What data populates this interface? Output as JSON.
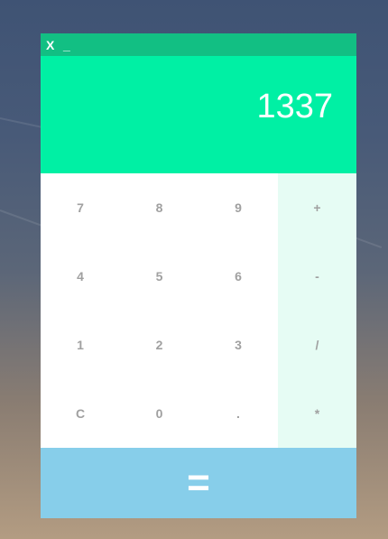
{
  "window": {
    "close_label": "X",
    "minimize_label": "_"
  },
  "display": {
    "value": "1337"
  },
  "keypad": {
    "rows": [
      [
        "7",
        "8",
        "9",
        "+"
      ],
      [
        "4",
        "5",
        "6",
        "-"
      ],
      [
        "1",
        "2",
        "3",
        "/"
      ],
      [
        "C",
        "0",
        ".",
        "*"
      ]
    ]
  },
  "equals_label": "=",
  "colors": {
    "titlebar": "#12bf83",
    "display": "#00f0a4",
    "operator_column": "#e6fcf4",
    "equals": "#87ceea",
    "key_text": "#a0a0a0"
  }
}
